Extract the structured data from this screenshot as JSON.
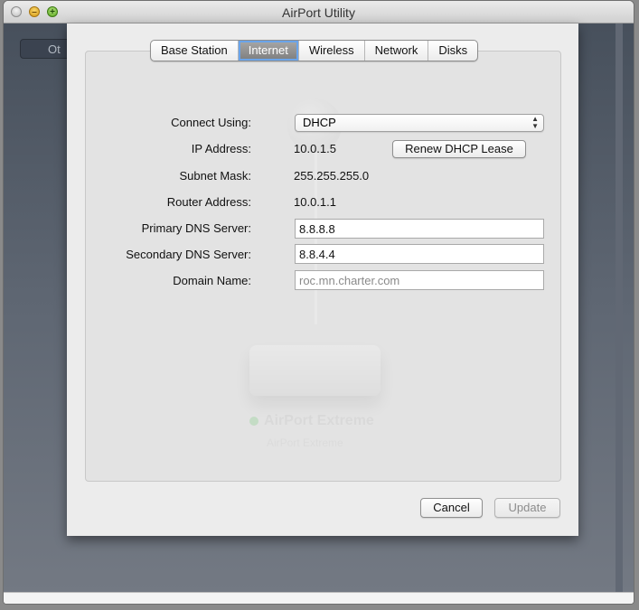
{
  "window": {
    "title": "AirPort Utility"
  },
  "background": {
    "left_button_label": "Ot"
  },
  "tabs": [
    "Base Station",
    "Internet",
    "Wireless",
    "Network",
    "Disks"
  ],
  "internet": {
    "connect_using_label": "Connect Using:",
    "connect_using_value": "DHCP",
    "ip_address_label": "IP Address:",
    "ip_address_value": "10.0.1.5",
    "renew_button": "Renew DHCP Lease",
    "subnet_mask_label": "Subnet Mask:",
    "subnet_mask_value": "255.255.255.0",
    "router_address_label": "Router Address:",
    "router_address_value": "10.0.1.1",
    "primary_dns_label": "Primary DNS Server:",
    "primary_dns_value": "8.8.8.8",
    "secondary_dns_label": "Secondary DNS Server:",
    "secondary_dns_value": "8.8.4.4",
    "domain_name_label": "Domain Name:",
    "domain_name_placeholder": "roc.mn.charter.com"
  },
  "watermark": {
    "device_name": "AirPort Extreme",
    "device_sub": "AirPort Extreme"
  },
  "footer": {
    "cancel": "Cancel",
    "update": "Update"
  },
  "icons": {
    "window_close": "close-icon",
    "window_minimize": "minimize-icon",
    "window_zoom": "zoom-icon",
    "select_arrows": "up-down-arrows-icon"
  }
}
